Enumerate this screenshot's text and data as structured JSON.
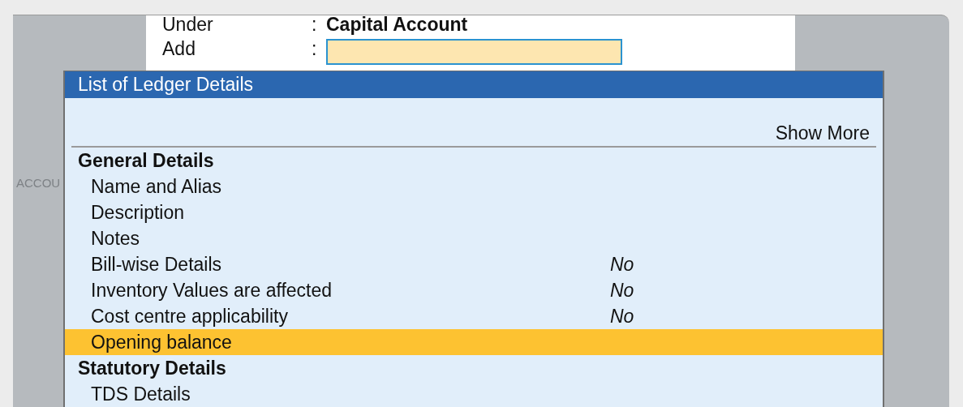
{
  "form": {
    "fields": [
      {
        "label": "Under",
        "separator": ":",
        "value": "Capital Account",
        "kind": "text"
      },
      {
        "label": "Add",
        "separator": ":",
        "kind": "input"
      }
    ]
  },
  "background_text": "ACCOU",
  "popup": {
    "title": "List of Ledger Details",
    "show_more": "Show More",
    "rows": [
      {
        "kind": "heading",
        "label": "General Details",
        "selected": false
      },
      {
        "kind": "item",
        "label": "Name and Alias",
        "selected": false
      },
      {
        "kind": "item",
        "label": "Description",
        "selected": false
      },
      {
        "kind": "item",
        "label": "Notes",
        "selected": false
      },
      {
        "kind": "item",
        "label": "Bill-wise Details",
        "value": "No",
        "selected": false
      },
      {
        "kind": "item",
        "label": "Inventory Values are affected",
        "value": "No",
        "selected": false
      },
      {
        "kind": "item",
        "label": "Cost centre applicability",
        "value": "No",
        "selected": false
      },
      {
        "kind": "item",
        "label": "Opening balance",
        "selected": true
      },
      {
        "kind": "heading",
        "label": "Statutory Details",
        "selected": false
      },
      {
        "kind": "item",
        "label": "TDS Details",
        "selected": false
      }
    ]
  }
}
